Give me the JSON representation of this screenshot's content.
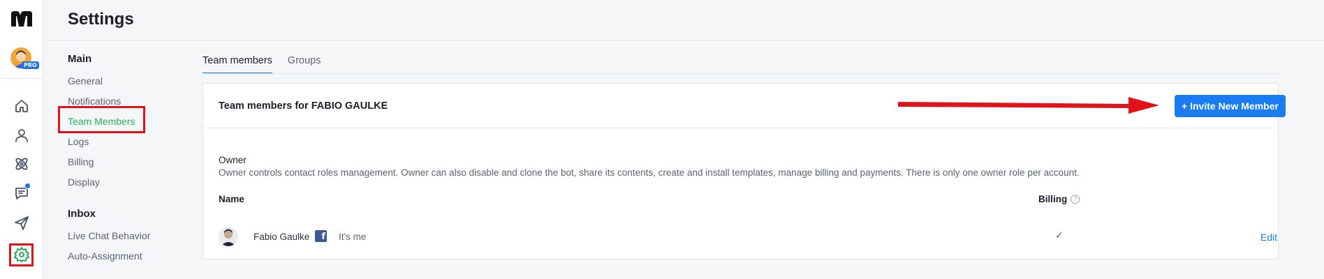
{
  "header": {
    "title": "Settings"
  },
  "rail": {
    "pro_badge": "PRO",
    "icons": [
      "home-icon",
      "user-icon",
      "atom-icon",
      "chat-icon",
      "send-icon",
      "gear-icon"
    ]
  },
  "subnav": {
    "sections": [
      {
        "title": "Main",
        "items": [
          "General",
          "Notifications",
          "Team Members",
          "Logs",
          "Billing",
          "Display"
        ]
      },
      {
        "title": "Inbox",
        "items": [
          "Live Chat Behavior",
          "Auto-Assignment"
        ]
      }
    ],
    "active_item": "Team Members"
  },
  "tabs": [
    "Team members",
    "Groups"
  ],
  "card": {
    "title": "Team members for FABIO GAULKE",
    "invite_label": "+ Invite New Member",
    "role_title": "Owner",
    "role_desc": "Owner controls contact roles management. Owner can also disable and clone the bot, share its contents, create and install templates, manage billing and payments. There is only one owner role per account.",
    "columns": {
      "name": "Name",
      "billing": "Billing",
      "help": "?"
    },
    "members": [
      {
        "name": "Fabio Gaulke",
        "facebook": "f",
        "note": "It's me",
        "billing_check": "✓",
        "edit": "Edit"
      }
    ]
  },
  "colors": {
    "accent": "#1a7cf0",
    "active_green": "#22b35a",
    "annotation_red": "#e0131a"
  }
}
